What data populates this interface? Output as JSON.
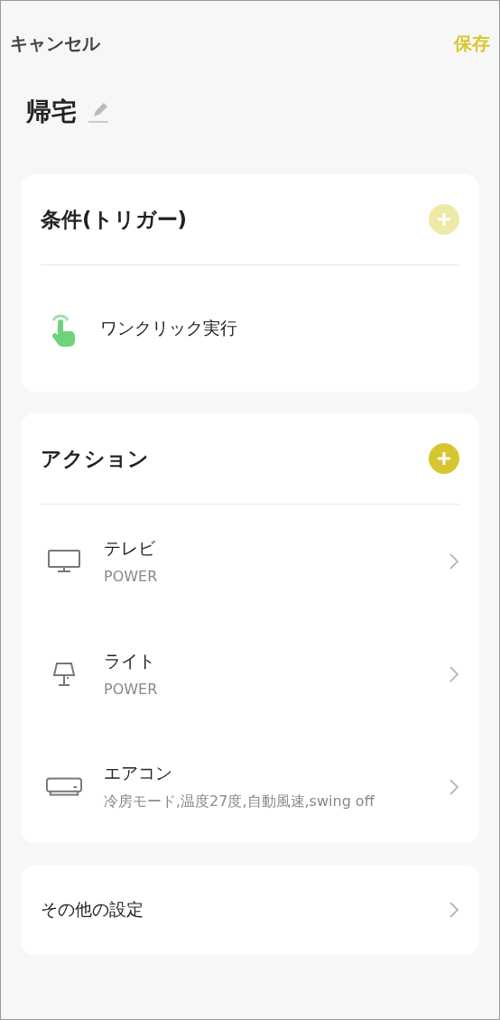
{
  "header": {
    "cancel": "キャンセル",
    "save": "保存"
  },
  "scene": {
    "title": "帰宅"
  },
  "conditions": {
    "title": "条件(トリガー)",
    "add_disabled": true,
    "items": [
      {
        "kind": "tap",
        "label": "ワンクリック実行"
      }
    ]
  },
  "actions": {
    "title": "アクション",
    "add_disabled": false,
    "items": [
      {
        "kind": "tv",
        "name": "テレビ",
        "detail": "POWER"
      },
      {
        "kind": "lamp",
        "name": "ライト",
        "detail": "POWER"
      },
      {
        "kind": "aircon",
        "name": "エアコン",
        "detail": "冷房モード,温度27度,自動風速,swing off"
      }
    ]
  },
  "other": {
    "label": "その他の設定"
  }
}
